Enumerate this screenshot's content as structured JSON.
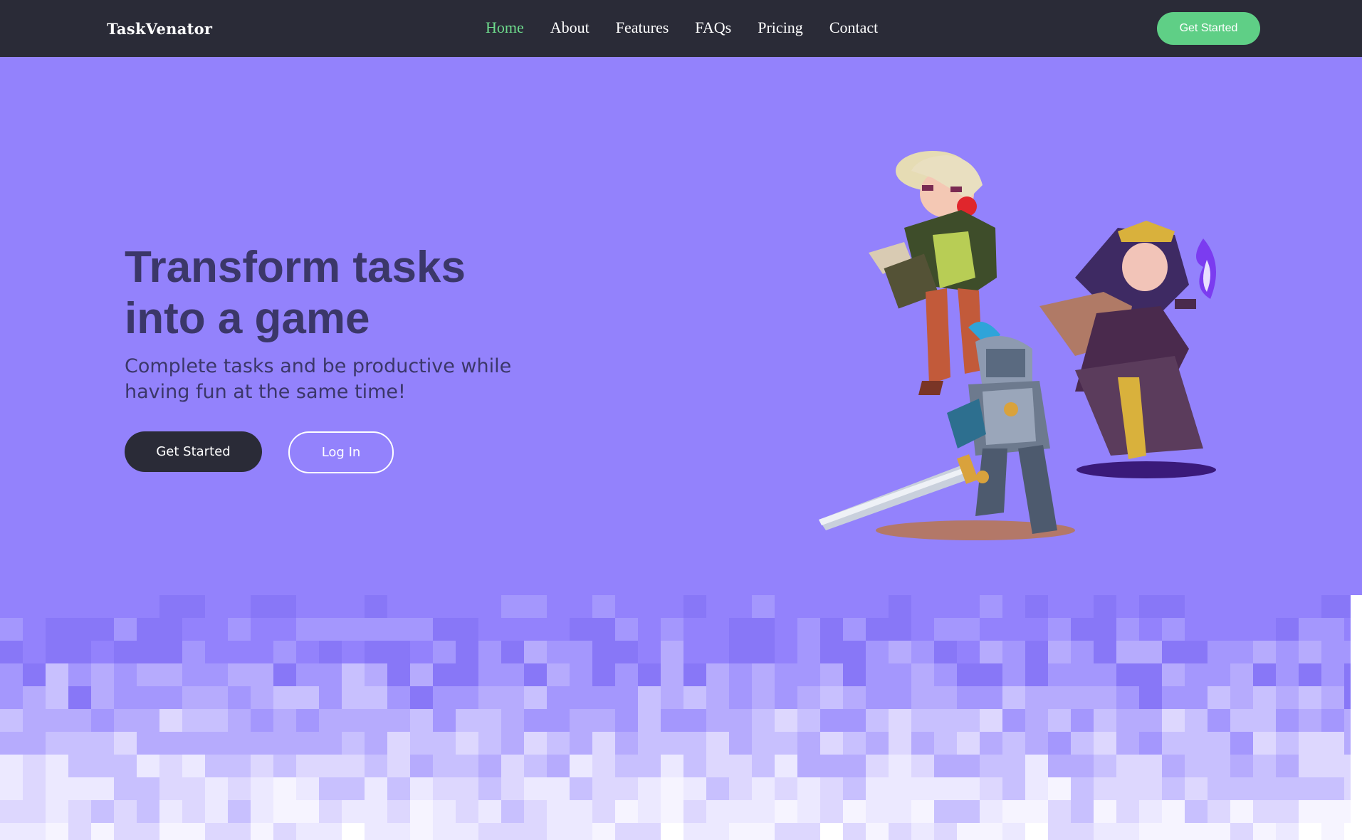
{
  "nav": {
    "brand": "TaskVenator",
    "links": [
      {
        "label": "Home",
        "active": true
      },
      {
        "label": "About",
        "active": false
      },
      {
        "label": "Features",
        "active": false
      },
      {
        "label": "FAQs",
        "active": false
      },
      {
        "label": "Pricing",
        "active": false
      },
      {
        "label": "Contact",
        "active": false
      }
    ],
    "cta_label": "Get Started"
  },
  "hero": {
    "title_line1": "Transform tasks",
    "title_line2": "into a game",
    "subtitle": "Complete tasks and be productive while having fun at the same time!",
    "primary_button": "Get Started",
    "secondary_button": "Log In"
  },
  "colors": {
    "hero_background": "#9382fc",
    "navbar_background": "#2a2b37",
    "active_link": "#6edb8c",
    "nav_cta": "#5fcf86",
    "heading_text": "#3b3769",
    "primary_button": "#2a2b37"
  },
  "illustration": {
    "characters": [
      "elf-archer",
      "armored-knight",
      "dark-mage"
    ]
  }
}
